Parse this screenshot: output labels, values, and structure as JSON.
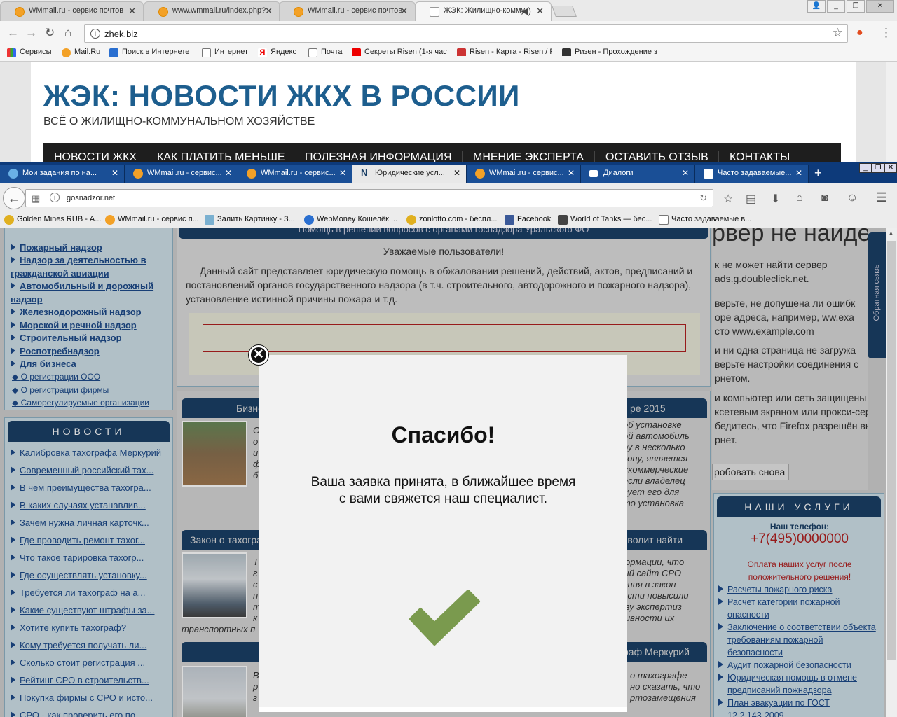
{
  "chrome": {
    "tabs": [
      {
        "title": "WMmail.ru - сервис почтов",
        "active": false
      },
      {
        "title": "www.wmmail.ru/index.php?",
        "active": false
      },
      {
        "title": "WMmail.ru - сервис почтов",
        "active": false
      },
      {
        "title": "ЖЭК: Жилищно-комму",
        "active": true
      }
    ],
    "url": "zhek.biz",
    "bookmarks": [
      "Сервисы",
      "Mail.Ru",
      "Поиск в Интернете",
      "Интернет",
      "Яндекс",
      "Почта",
      "Секреты Risen (1-я час",
      "Risen - Карта - Risen / F",
      "Ризен - Прохождение з"
    ]
  },
  "zhek": {
    "title": "ЖЭК: НОВОСТИ ЖКХ В РОССИИ",
    "subtitle": "ВСЁ О ЖИЛИЩНО-КОММУНАЛЬНОМ ХОЗЯЙСТВЕ",
    "nav": [
      "НОВОСТИ ЖКХ",
      "КАК ПЛАТИТЬ МЕНЬШЕ",
      "ПОЛЕЗНАЯ ИНФОРМАЦИЯ",
      "МНЕНИЕ ЭКСПЕРТА",
      "ОСТАВИТЬ ОТЗЫВ",
      "КОНТАКТЫ"
    ]
  },
  "firefox": {
    "tabs": [
      {
        "title": "Мои задания по на...",
        "active": false
      },
      {
        "title": "WMmail.ru - сервис...",
        "active": false
      },
      {
        "title": "WMmail.ru - сервис...",
        "active": false
      },
      {
        "title": "Юридические усл...",
        "active": true
      },
      {
        "title": "WMmail.ru - сервис...",
        "active": false
      },
      {
        "title": "Диалоги",
        "active": false
      },
      {
        "title": "Часто задаваемые...",
        "active": false
      }
    ],
    "url": "gosnadzor.net",
    "bookmarks": [
      "Golden Mines RUB - А...",
      "WMmail.ru - сервис п...",
      "Залить Картинку - З...",
      "WebMoney Кошелёк ...",
      "zonlotto.com - беспл...",
      "Facebook",
      "World of Tanks — бес...",
      "Часто задаваемые в..."
    ]
  },
  "gosnadzor": {
    "sidebar_links": [
      "Пожарный надзор",
      "Надзор за деятельностью в",
      "гражданской авиации",
      "Автомобильный и дорожный",
      "надзор",
      "Железнодорожный надзор",
      "Морской и речной надзор",
      "Строительный надзор",
      "Роспотребнадзор",
      "Для бизнеса"
    ],
    "sub_links": [
      "О регистрации ООО",
      "О регистрации фирмы",
      "Саморегулируемые организации"
    ],
    "news_title": "НОВОСТИ",
    "news": [
      "Калибровка тахографа Меркурий",
      "Современный российский тах...",
      "В чем преимущества тахогра...",
      "В каких случаях устанавлив...",
      "Зачем нужна личная карточк...",
      "Где проводить ремонт тахог...",
      "Что такое тарировка тахогр...",
      "Где осуществлять установку...",
      "Требуется ли тахограф на а...",
      "Какие существуют штрафы за...",
      "Хотите купить тахограф?",
      "Кому требуется получать ли...",
      "Сколько стоит регистрация ...",
      "Рейтинг СРО в строительств...",
      "Покупка фирмы с СРО и исто...",
      "СРО - как проверить его по..."
    ],
    "center_top": "Помощь в решении вопросов с органами госнадзора Уральского ФО",
    "greeting": "Уважаемые пользователи!",
    "intro": [
      "Данный сайт представляет юридическую помощь в обжаловании решений, действий, актов, предписаний и",
      "постановлений органов государственного надзора (в т.ч. строительного, автодорожного и пожарного надзора),",
      "установление истинной причины пожара и т.д."
    ],
    "article_heads": [
      "Бизне",
      "ре 2015",
      "Закон о тахогра",
      "зволит найти",
      "раф Меркурий"
    ],
    "article_right_1": [
      "об   установке",
      "ой  автомобиль",
      "ру в  несколько",
      "кону,  является",
      "«коммерческие",
      "если  владелец",
      "вует   его   для",
      "то  установка"
    ],
    "article_left_1": [
      "С",
      "о",
      "и",
      "ф",
      "б"
    ],
    "article_right_2": [
      "формации,   что",
      "ный  сайт  СРО",
      "ления  в  закон",
      "ности повысили",
      "тву  экспертиз",
      "тивности     их"
    ],
    "article_left_2": [
      "Т",
      "г",
      "с",
      "п",
      "т",
      "к"
    ],
    "article_tail_2": "транспортных п",
    "article_right_3": [
      "о     тахографе",
      "но  сказать,  что",
      "ртозамещения"
    ],
    "article_left_3": [
      "В",
      "р",
      "з"
    ],
    "error": {
      "head": "рвер не найде",
      "lines": [
        "к не может найти сервер",
        "ads.g.doubleclick.net.",
        "верьте, не допущена ли ошибк",
        "оре адреса, например, ww.exa",
        "сто www.example.com",
        "и ни одна страница не загружа",
        "верьте настройки соединения с",
        "рнетом.",
        "и компьютер или сеть защищены",
        "ксетевым экраном или прокси-серв",
        "бедитесь, что Firefox разрешён вы",
        "рнет."
      ],
      "retry": "робовать снова"
    },
    "feedback_tab": "Обратная связь",
    "services_title": "НАШИ УСЛУГИ",
    "phone_label": "Наш телефон:",
    "phone": "+7(495)0000000",
    "pay_note": [
      "Оплата наших услуг после",
      "положительного решения!"
    ],
    "services": [
      "Расчеты пожарного риска",
      "Расчет категории пожарной",
      "опасности",
      "Заключение о соответствии объекта",
      "требованиям пожарной",
      "безопасности",
      "Аудит пожарной безопасности",
      "Юридическая помощь в отмене",
      "предписаний пожнадзора",
      "План эвакуации по ГОСТ",
      "12.2.143-2009"
    ]
  },
  "modal": {
    "title": "Спасибо!",
    "message": "Ваша заявка принята, в ближайшее время с вами свяжется наш специалист.",
    "check_color": "#7a9a4e"
  }
}
